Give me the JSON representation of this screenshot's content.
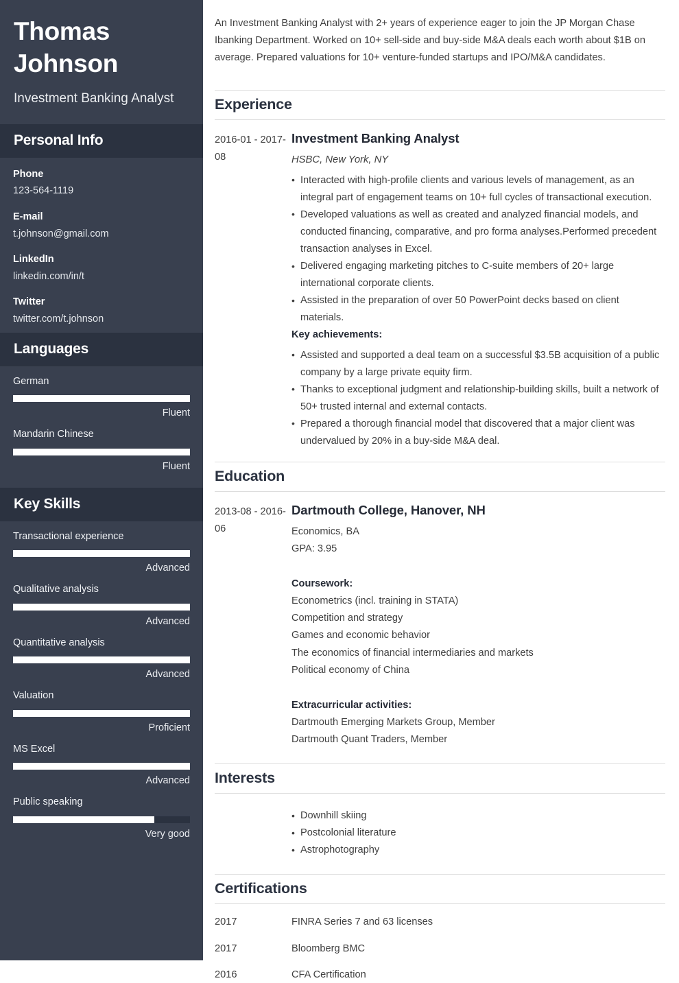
{
  "sidebar": {
    "full_name": "Thomas Johnson",
    "job_title": "Investment Banking Analyst",
    "personal_info": {
      "heading": "Personal Info",
      "items": [
        {
          "label": "Phone",
          "value": "123-564-1119"
        },
        {
          "label": "E-mail",
          "value": "t.johnson@gmail.com"
        },
        {
          "label": "LinkedIn",
          "value": "linkedin.com/in/t"
        },
        {
          "label": "Twitter",
          "value": "twitter.com/t.johnson"
        }
      ]
    },
    "languages": {
      "heading": "Languages",
      "items": [
        {
          "name": "German",
          "level": "Fluent",
          "percent": 100
        },
        {
          "name": "Mandarin Chinese",
          "level": "Fluent",
          "percent": 100
        }
      ]
    },
    "key_skills": {
      "heading": "Key Skills",
      "items": [
        {
          "name": "Transactional experience",
          "level": "Advanced",
          "percent": 100
        },
        {
          "name": "Qualitative analysis",
          "level": "Advanced",
          "percent": 100
        },
        {
          "name": "Quantitative analysis",
          "level": "Advanced",
          "percent": 100
        },
        {
          "name": "Valuation",
          "level": "Proficient",
          "percent": 100
        },
        {
          "name": "MS Excel",
          "level": "Advanced",
          "percent": 100
        },
        {
          "name": "Public speaking",
          "level": "Very good",
          "percent": 80
        }
      ]
    }
  },
  "main": {
    "summary": "An Investment Banking Analyst with 2+ years of experience eager to join the JP Morgan Chase Ibanking Department. Worked on 10+ sell-side and buy-side M&A deals each worth about $1B on average. Prepared valuations for 10+ venture-funded startups and IPO/M&A candidates.",
    "experience": {
      "heading": "Experience",
      "entry": {
        "date": "2016-01 - 2017-08",
        "title": "Investment Banking Analyst",
        "subtitle": "HSBC, New York, NY",
        "bullets": [
          "Interacted with high-profile clients and various levels of management, as an integral part of engagement teams on 10+ full cycles of transactional execution.",
          "Developed valuations as well as created and analyzed financial models, and conducted financing, comparative, and pro forma analyses.Performed precedent transaction analyses in Excel.",
          "Delivered engaging marketing pitches to C-suite members of 20+ large international corporate clients.",
          "Assisted in the preparation of over 50 PowerPoint decks based on client materials."
        ],
        "achievements_heading": "Key achievements:",
        "achievements": [
          "Assisted and supported a deal team on a successful $3.5B acquisition of a public company by a large private equity firm.",
          "Thanks to exceptional judgment and relationship-building skills, built a network of 50+ trusted internal and external contacts.",
          "Prepared a thorough financial model that discovered that a major client was undervalued by 20% in a buy-side M&A deal."
        ]
      }
    },
    "education": {
      "heading": "Education",
      "entry": {
        "date": "2013-08 - 2016-06",
        "title": "Dartmouth College, Hanover, NH",
        "degree": "Economics, BA",
        "gpa": "GPA: 3.95",
        "coursework_heading": "Coursework:",
        "coursework": [
          "Econometrics (incl. training in STATA)",
          "Competition and strategy",
          "Games and economic behavior",
          "The economics of financial intermediaries and markets",
          "Political economy of China"
        ],
        "extracurricular_heading": "Extracurricular activities:",
        "extracurricular": [
          "Dartmouth Emerging Markets Group, Member",
          "Dartmouth Quant Traders, Member"
        ]
      }
    },
    "interests": {
      "heading": "Interests",
      "items": [
        "Downhill skiing",
        "Postcolonial literature",
        "Astrophotography"
      ]
    },
    "certifications": {
      "heading": "Certifications",
      "items": [
        {
          "year": "2017",
          "name": "FINRA Series 7 and 63 licenses"
        },
        {
          "year": "2017",
          "name": "Bloomberg BMC"
        },
        {
          "year": "2016",
          "name": "CFA Certification"
        }
      ]
    }
  },
  "theme": {
    "sidebar_bg": "#39404f",
    "sidebar_head_bg": "#2b3240",
    "bar_fill": "#ffffff",
    "heading_color": "#2b3240",
    "body_text": "#3f3f3f",
    "rule_color": "#dddddd"
  }
}
